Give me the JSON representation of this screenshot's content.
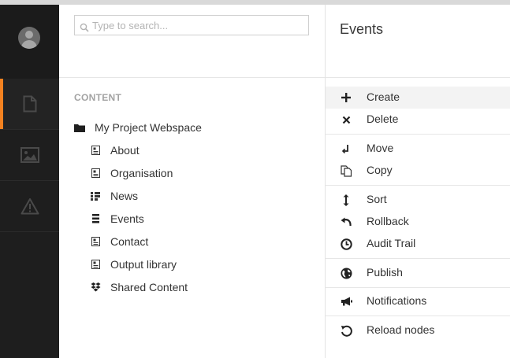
{
  "search": {
    "placeholder": "Type to search..."
  },
  "rail": {
    "items": [
      {
        "icon": "document-icon",
        "active": true
      },
      {
        "icon": "image-icon",
        "active": false
      },
      {
        "icon": "warning-icon",
        "active": false
      }
    ],
    "accent_color": "#f58220"
  },
  "tree": {
    "section_label": "CONTENT",
    "root": {
      "label": "My Project Webspace",
      "icon": "folder-icon"
    },
    "children": [
      {
        "label": "About",
        "icon": "page-icon"
      },
      {
        "label": "Organisation",
        "icon": "page-icon"
      },
      {
        "label": "News",
        "icon": "grid-list-icon"
      },
      {
        "label": "Events",
        "icon": "list-icon"
      },
      {
        "label": "Contact",
        "icon": "page-icon"
      },
      {
        "label": "Output library",
        "icon": "page-icon"
      },
      {
        "label": "Shared Content",
        "icon": "dropbox-icon"
      }
    ]
  },
  "actions": {
    "title": "Events",
    "items": [
      {
        "label": "Create",
        "icon": "plus-icon"
      },
      {
        "label": "Delete",
        "icon": "times-icon"
      },
      {
        "label": "Move",
        "icon": "move-icon"
      },
      {
        "label": "Copy",
        "icon": "copy-icon"
      },
      {
        "label": "Sort",
        "icon": "sort-icon"
      },
      {
        "label": "Rollback",
        "icon": "undo-icon"
      },
      {
        "label": "Audit Trail",
        "icon": "clock-icon"
      },
      {
        "label": "Publish",
        "icon": "globe-icon"
      },
      {
        "label": "Notifications",
        "icon": "megaphone-icon"
      },
      {
        "label": "Reload nodes",
        "icon": "reload-icon"
      }
    ]
  }
}
